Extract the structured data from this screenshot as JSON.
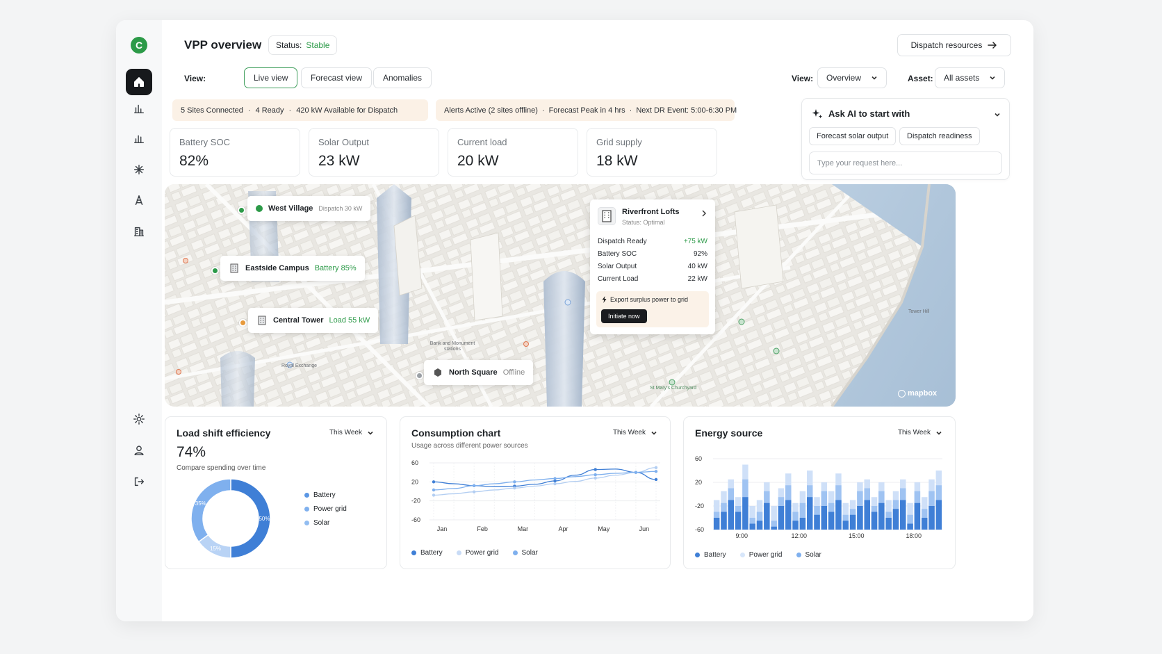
{
  "app": {
    "logo_letter": "C",
    "title": "VPP overview",
    "status_label": "Status:",
    "status_value": "Stable",
    "dispatch_button": "Dispatch resources"
  },
  "view_tabs": {
    "label": "View:",
    "tabs": [
      "Live view",
      "Forecast view",
      "Anomalies"
    ],
    "active": "Live view"
  },
  "filters": {
    "view_label": "View:",
    "view_value": "Overview",
    "asset_label": "Asset:",
    "asset_value": "All assets"
  },
  "banners": {
    "left": [
      "5 Sites Connected",
      "4 Ready",
      "420 kW Available for Dispatch"
    ],
    "right": [
      "Alerts Active (2 sites offline)",
      "Forecast Peak in 4 hrs",
      "Next DR Event: 5:00-6:30 PM"
    ],
    "separator": "·"
  },
  "stats": [
    {
      "label": "Battery SOC",
      "value": "82%"
    },
    {
      "label": "Solar Output",
      "value": "23 kW"
    },
    {
      "label": "Current load",
      "value": "20 kW"
    },
    {
      "label": "Grid supply",
      "value": "18 kW"
    }
  ],
  "ai": {
    "title": "Ask AI to start with",
    "suggestions": [
      "Forecast solar output",
      "Dispatch readiness"
    ],
    "placeholder": "Type your request here..."
  },
  "map": {
    "sites": [
      {
        "name": "West Village",
        "detail": "Dispatch 30 kW",
        "marker": "#2c9a48"
      },
      {
        "name": "Eastside Campus",
        "detail": "Battery 85%",
        "marker": "#2c9a48"
      },
      {
        "name": "Central Tower",
        "detail": "Load 55 kW",
        "marker": "#e89a3c"
      },
      {
        "name": "North Square",
        "detail": "Offline",
        "marker": "#9ca1a6"
      }
    ],
    "popup": {
      "name": "Riverfront Lofts",
      "status": "Status: Optimal",
      "rows": [
        {
          "label": "Dispatch Ready",
          "value": "+75 kW"
        },
        {
          "label": "Battery SOC",
          "value": "92%"
        },
        {
          "label": "Solar Output",
          "value": "40 kW"
        },
        {
          "label": "Current Load",
          "value": "22 kW"
        }
      ],
      "action_text": "Export surplus power to grid",
      "action_button": "Initiate now"
    },
    "place_labels": [
      "Bank and Monument stations",
      "Royal Exchange",
      "St Mary's Churchyard",
      "Tower Hill"
    ],
    "attribution": "mapbox"
  },
  "load_shift": {
    "title": "Load shift efficiency",
    "period": "This Week",
    "value": "74%",
    "subtitle": "Compare spending over time",
    "legend": [
      "Battery",
      "Power grid",
      "Solar"
    ]
  },
  "consumption": {
    "title": "Consumption chart",
    "period": "This Week",
    "subtitle": "Usage across different power sources",
    "legend": [
      "Battery",
      "Power grid",
      "Solar"
    ]
  },
  "energy_source": {
    "title": "Energy source",
    "period": "This Week",
    "legend": [
      "Battery",
      "Power grid",
      "Solar"
    ]
  },
  "chart_data": [
    {
      "type": "pie",
      "title": "Load shift efficiency",
      "categories": [
        "Battery",
        "Power grid",
        "Solar"
      ],
      "values": [
        50,
        15,
        35
      ],
      "slice_labels": [
        "50%",
        "15%",
        "35%"
      ],
      "colors": [
        "#3f7fd6",
        "#b9d3f5",
        "#7fb0ee"
      ]
    },
    {
      "type": "line",
      "title": "Consumption chart",
      "x": [
        "Jan",
        "",
        "Feb",
        "",
        "Mar",
        "",
        "Apr",
        "",
        "May",
        "",
        "Jun",
        ""
      ],
      "x_tick_labels": [
        "Jan",
        "Feb",
        "Mar",
        "Apr",
        "May",
        "Jun"
      ],
      "ylim": [
        -60,
        60
      ],
      "y_ticks": [
        "60",
        "20",
        "-20",
        "-60"
      ],
      "series": [
        {
          "name": "Battery",
          "color": "#3f7fd6",
          "values": [
            20,
            16,
            12,
            10,
            11,
            15,
            22,
            34,
            46,
            47,
            40,
            25
          ]
        },
        {
          "name": "Power grid",
          "color": "#b3cef2",
          "values": [
            -8,
            -5,
            -1,
            3,
            7,
            11,
            16,
            21,
            28,
            34,
            40,
            50
          ]
        },
        {
          "name": "Solar",
          "color": "#7fb0ee",
          "values": [
            3,
            6,
            12,
            16,
            20,
            24,
            27,
            31,
            35,
            38,
            40,
            42
          ]
        }
      ]
    },
    {
      "type": "bar",
      "title": "Energy source",
      "stacked": true,
      "x_tick_labels": [
        "9:00",
        "12:00",
        "15:00",
        "18:00"
      ],
      "ylim": [
        -60,
        60
      ],
      "y_ticks": [
        "60",
        "20",
        "-20",
        "-60"
      ],
      "series": [
        {
          "name": "Battery",
          "color": "#3f7fd6",
          "values": [
            -40,
            -30,
            -10,
            -30,
            -5,
            -50,
            -45,
            -15,
            -55,
            -20,
            -10,
            -45,
            -40,
            -5,
            -35,
            -20,
            -30,
            -10,
            -45,
            -35,
            -20,
            -10,
            -30,
            -15,
            -40,
            -25,
            -10,
            -50,
            -15,
            -40,
            -20,
            -10
          ]
        },
        {
          "name": "Power grid",
          "color": "#9fc3f2",
          "values": [
            -30,
            -15,
            10,
            -20,
            25,
            -40,
            -30,
            5,
            -45,
            -5,
            15,
            -30,
            -15,
            15,
            -20,
            5,
            -15,
            15,
            -35,
            -25,
            5,
            10,
            -20,
            5,
            -30,
            -10,
            10,
            -35,
            5,
            -25,
            5,
            15
          ]
        },
        {
          "name": "Solar",
          "color": "#cfe0f8",
          "values": [
            -10,
            5,
            25,
            -5,
            50,
            -20,
            -10,
            20,
            -20,
            10,
            35,
            -15,
            5,
            40,
            -5,
            20,
            5,
            35,
            -15,
            -10,
            20,
            25,
            -5,
            20,
            -10,
            5,
            25,
            -15,
            20,
            -5,
            25,
            40
          ]
        }
      ]
    }
  ]
}
